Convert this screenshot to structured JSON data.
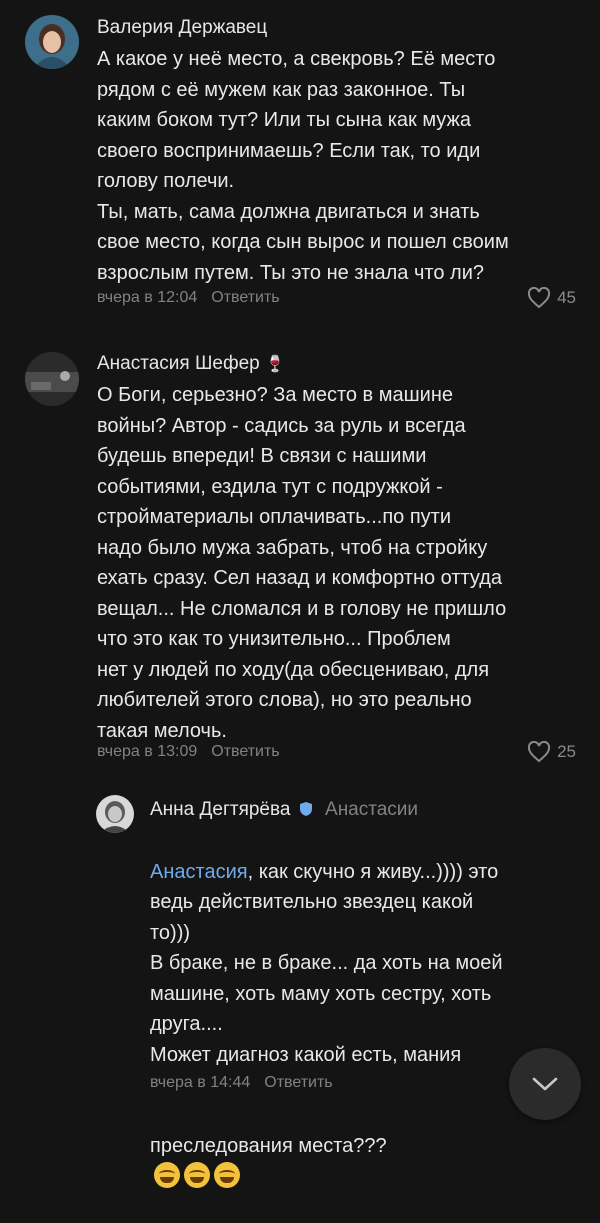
{
  "comments": [
    {
      "author": "Валерия Державец",
      "lines": "А какое у неё место, а свекровь? Её место\nрядом с её мужем как раз законное. Ты\nкаким боком тут? Или ты сына как мужа\nсвоего воспринимаешь? Если так, то иди\nголову полечи.\nТы, мать, сама должна двигаться и знать\nсвое место, когда сын вырос и пошел своим\nвзрослым путем. Ты это не знала что ли?",
      "time": "вчера в 12:04",
      "reply": "Ответить",
      "likes": "45"
    },
    {
      "author": "Анастасия Шефер",
      "author_emoji": "🍷",
      "lines": "О Боги, серьезно? За место в машине\nвойны? Автор - садись за руль и всегда\nбудешь впереди! В связи с нашими\nсобытиями, ездила тут с подружкой -\nстройматериалы оплачивать...по пути\nнадо было мужа забрать, чтоб на стройку\nехать сразу. Сел назад и комфортно оттуда\nвещал... Не сломался и в голову не пришло\nчто это как то унизительно... Проблем\nнет у людей по ходу(да обесцениваю, для\nлюбителей этого слова), но это реально\nтакая мелочь.",
      "time": "вчера в 13:09",
      "reply": "Ответить",
      "likes": "25"
    }
  ],
  "reply_comment": {
    "author": "Анна Дегтярёва",
    "reply_to": "Анастасии",
    "mention": "Анастасия",
    "first_line_rest": ", как скучно я живу...)))) это",
    "lines": "ведь действительно звездец какой\nто)))\nВ браке, не в браке... да хоть на моей\nмашине, хоть маму хоть сестру, хоть\nдруга....\nМожет диагноз какой есть, мания",
    "last_line": "преследования места???",
    "time": "вчера в 14:44",
    "reply": "Ответить"
  },
  "icons": {
    "like": "heart-outline-icon",
    "scroll": "chevron-down-icon"
  },
  "colors": {
    "background": "#141414",
    "mention": "#71aaeb",
    "meta": "#828282"
  }
}
